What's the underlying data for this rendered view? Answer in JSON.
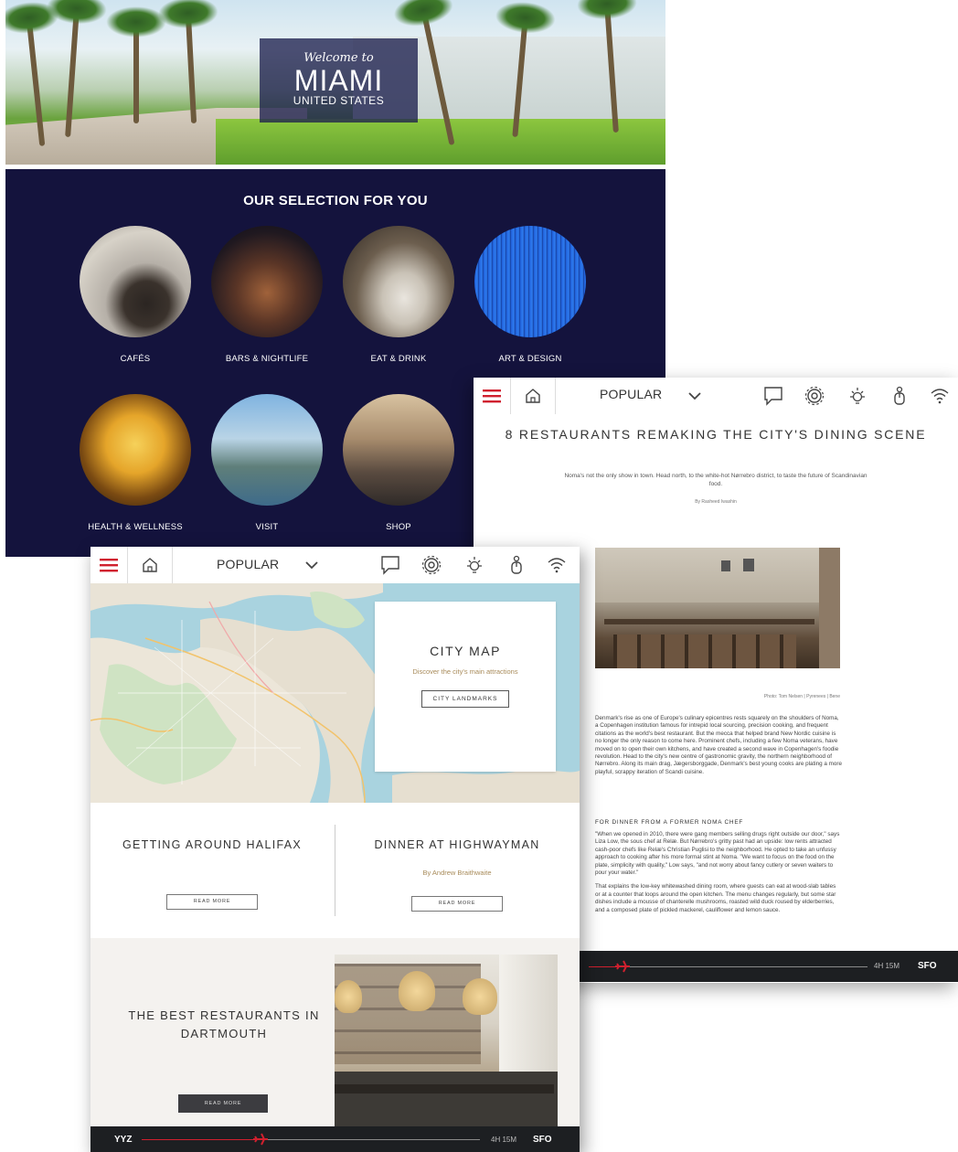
{
  "miami": {
    "welcome": "Welcome to",
    "city": "MIAMI",
    "country": "UNITED STATES",
    "selection_title": "OUR SELECTION FOR YOU",
    "categories": [
      {
        "label": "CAFÉS",
        "icon": "cafe-photo"
      },
      {
        "label": "BARS & NIGHTLIFE",
        "icon": "bar-photo"
      },
      {
        "label": "EAT & DRINK",
        "icon": "restaurant-photo"
      },
      {
        "label": "ART & DESIGN",
        "icon": "art-photo"
      },
      {
        "label": "HEALTH & WELLNESS",
        "icon": "wellness-photo"
      },
      {
        "label": "VISIT",
        "icon": "skyline-photo"
      },
      {
        "label": "SHOP",
        "icon": "street-photo"
      }
    ]
  },
  "toolbar": {
    "popular_label": "POPULAR",
    "icons": [
      "menu-icon",
      "home-icon",
      "chevron-down-icon",
      "chat-icon",
      "settings-icon",
      "brightness-icon",
      "attendant-icon",
      "wifi-icon"
    ]
  },
  "article": {
    "title": "8 RESTAURANTS REMAKING THE CITY'S DINING SCENE",
    "dek": "Noma's not the only show in town. Head north, to the white-hot Nørrebro district, to taste the future of Scandinavian food.",
    "byline": "By Rasheed Iwashin",
    "credit": "Photo: Tom Nelsen | Pyrenees | Bene",
    "para1": "Denmark's rise as one of Europe's culinary epicentres rests squarely on the shoulders of Noma, a Copenhagen institution famous for intrepid local sourcing, precision cooking, and frequent citations as the world's best restaurant. But the mecca that helped brand New Nordic cuisine is no longer the only reason to come here. Prominent chefs, including a few Noma veterans, have moved on to open their own kitchens, and have created a second wave in Copenhagen's foodie revolution. Head to the city's new centre of gastronomic gravity, the northern neighborhood of Nørrebro. Along its main drag, Jægersborggade, Denmark's best young cooks are plating a more playful, scrappy iteration of Scandi cuisine.",
    "subhead": "FOR DINNER FROM A FORMER NOMA CHEF",
    "para2": "\"When we opened in 2010, there were gang members selling drugs right outside our door,\" says Liza Low, the sous chef at Relæ. But Nørrebro's gritty past had an upside: low rents attracted cash-poor chefs like Relæ's Christian Puglisi to the neighborhood. He opted to take an unfussy approach to cooking after his more formal stint at Noma. \"We want to focus on the food on the plate, simplicity with quality,\" Low says, \"and not worry about fancy cutlery or seven waiters to pour your water.\"",
    "para3": "That explains the low-key whitewashed dining room, where guests can eat at wood-slab tables or at a counter that loops around the open kitchen. The menu changes regularly, but some star dishes include a mousse of chanterelle mushrooms, roasted wild duck roused by elderberries, and a composed plate of pickled mackerel, cauliflower and lemon sauce."
  },
  "flight_article": {
    "duration": "4H 15M",
    "destination": "SFO",
    "progress": 0.12
  },
  "halifax": {
    "map_card": {
      "title": "CITY MAP",
      "subtitle": "Discover the city's main attractions",
      "button": "CITY LANDMARKS"
    },
    "col1": {
      "title": "GETTING AROUND HALIFAX",
      "button": "READ MORE"
    },
    "col2": {
      "title": "DINNER AT HIGHWAYMAN",
      "byline": "By Andrew Braithwaite",
      "button": "READ MORE"
    },
    "promo": {
      "title": "THE BEST RESTAURANTS IN DARTMOUTH",
      "button": "READ MORE"
    },
    "flight": {
      "origin": "YYZ",
      "duration": "4H 15M",
      "destination": "SFO",
      "progress": 0.35
    }
  },
  "colors": {
    "navy": "#14133d",
    "accent_red": "#d0202e",
    "flightbar": "#1d1f22",
    "gold_text": "#a88b5a"
  }
}
